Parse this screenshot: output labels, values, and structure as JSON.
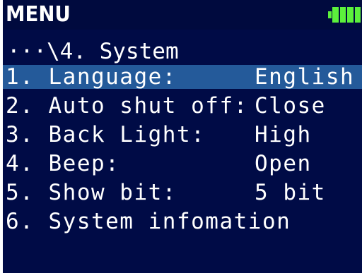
{
  "header": {
    "title": "MENU",
    "battery_color": "#5cf03c"
  },
  "breadcrumb": "···\\4. System",
  "menu": {
    "items": [
      {
        "label": "1. Language:",
        "value": "English",
        "selected": true
      },
      {
        "label": "2. Auto shut off:",
        "value": "Close",
        "selected": false
      },
      {
        "label": "3. Back Light:",
        "value": "High",
        "selected": false
      },
      {
        "label": "4. Beep:",
        "value": "Open",
        "selected": false
      },
      {
        "label": "5. Show bit:",
        "value": "5 bit",
        "selected": false
      },
      {
        "label": "6. System infomation",
        "value": "",
        "selected": false
      }
    ]
  },
  "colors": {
    "background": "#000b46",
    "selection": "#245a9a",
    "text": "#ffffff"
  }
}
